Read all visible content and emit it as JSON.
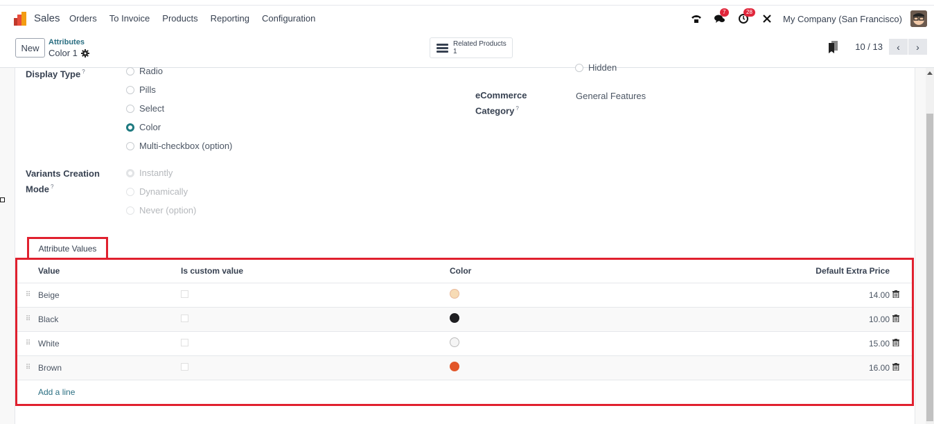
{
  "navbar": {
    "app_name": "Sales",
    "menu": [
      "Orders",
      "To Invoice",
      "Products",
      "Reporting",
      "Configuration"
    ],
    "messages_badge": "7",
    "activities_badge": "28",
    "company": "My Company (San Francisco)"
  },
  "control_panel": {
    "new_label": "New",
    "breadcrumb_parent": "Attributes",
    "breadcrumb_current": "Color 1",
    "smart_button": {
      "label": "Related Products",
      "count": "1"
    },
    "pager": {
      "value": "10 / 13",
      "prev": "‹",
      "next": "›"
    }
  },
  "form": {
    "display_type": {
      "label": "Display Type",
      "help": "?",
      "options": [
        "Radio",
        "Pills",
        "Select",
        "Color",
        "Multi-checkbox (option)"
      ],
      "selected": "Color"
    },
    "hidden_option": "Hidden",
    "ecommerce_category": {
      "label_line1": "eCommerce",
      "label_line2": "Category",
      "help": "?",
      "value": "General Features"
    },
    "variants_creation_mode": {
      "label_line1": "Variants Creation",
      "label_line2": "Mode",
      "help": "?",
      "options": [
        "Instantly",
        "Dynamically",
        "Never (option)"
      ],
      "selected": "Instantly"
    }
  },
  "tabs": {
    "attribute_values": "Attribute Values"
  },
  "attribute_values": {
    "columns": [
      "Value",
      "Is custom value",
      "Color",
      "Default Extra Price"
    ],
    "rows": [
      {
        "value": "Beige",
        "is_custom": false,
        "color": "#f7dbb5",
        "price": "14.00"
      },
      {
        "value": "Black",
        "is_custom": false,
        "color": "#1f1f22",
        "price": "10.00"
      },
      {
        "value": "White",
        "is_custom": false,
        "color": "#f5f5f5",
        "price": "15.00"
      },
      {
        "value": "Brown",
        "is_custom": false,
        "color": "#e2572a",
        "price": "16.00"
      }
    ],
    "add_line": "Add a line"
  }
}
